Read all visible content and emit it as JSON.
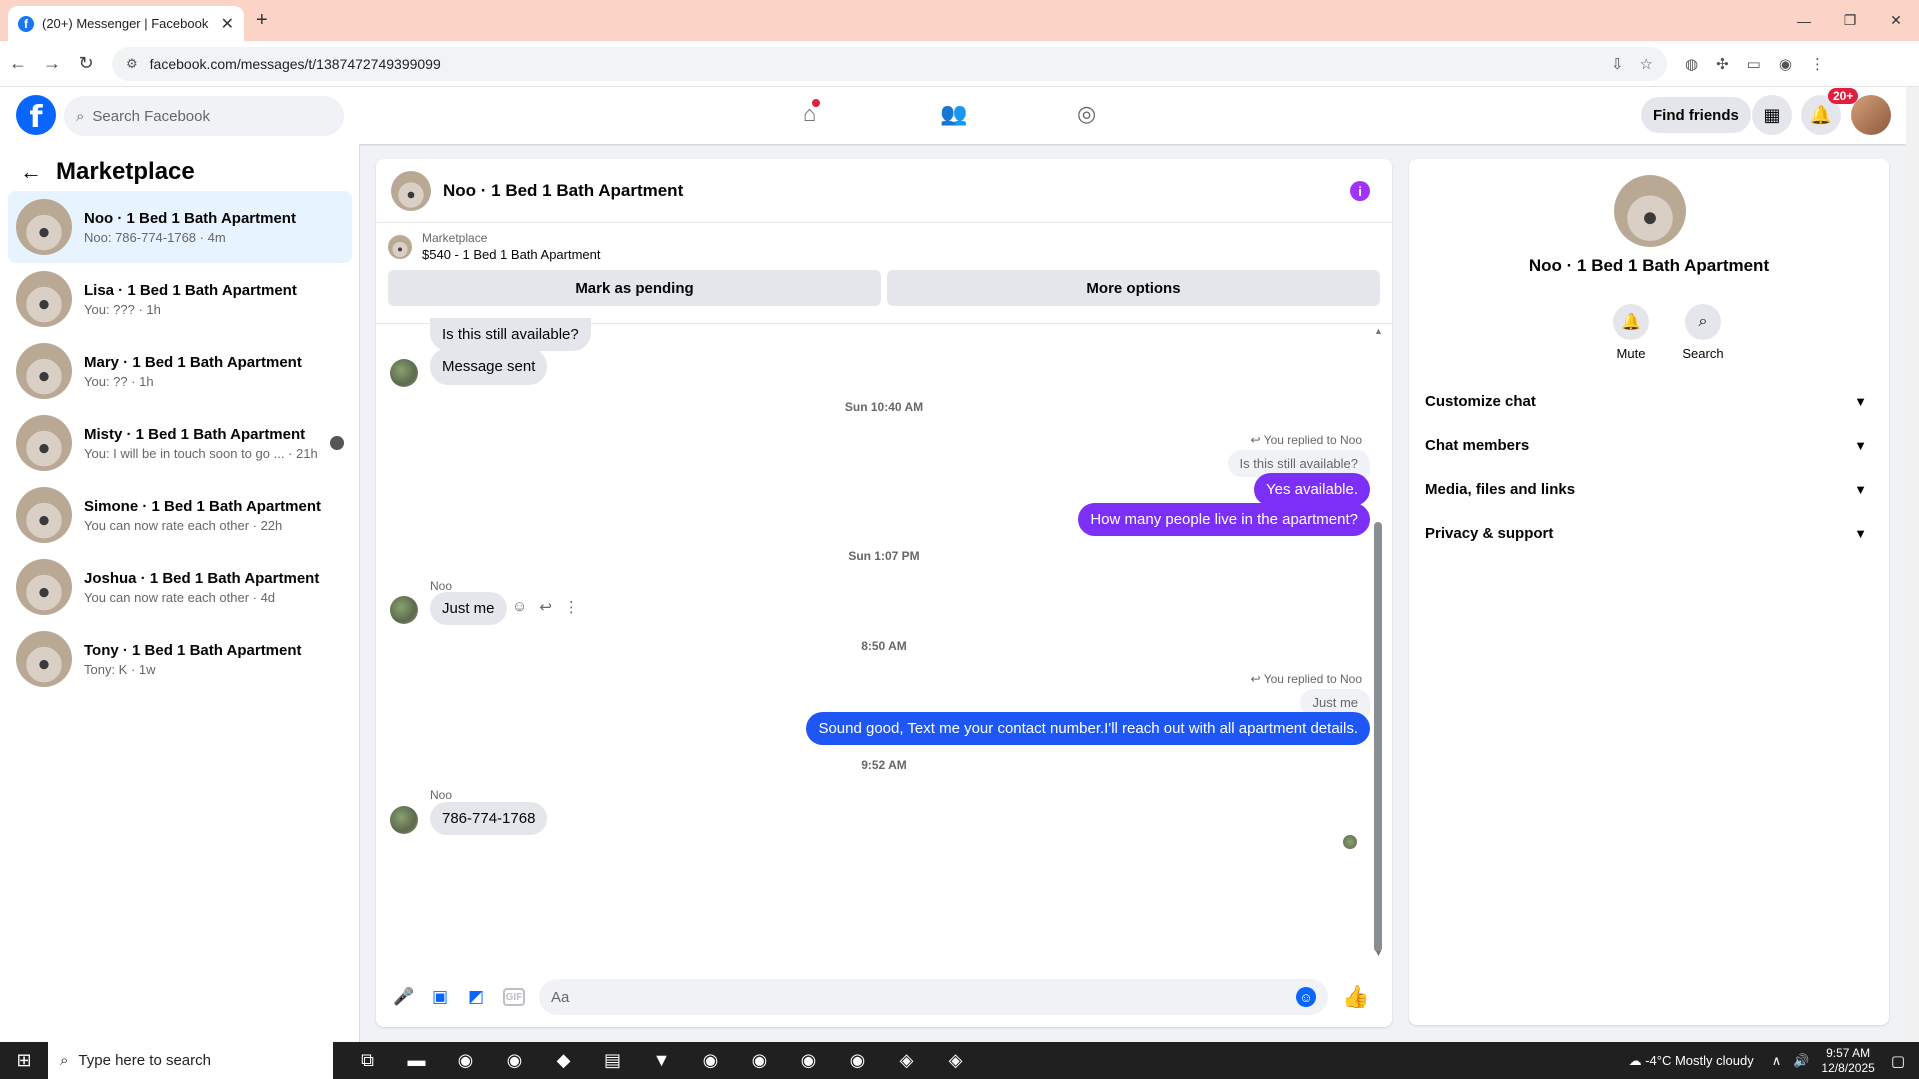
{
  "browser": {
    "tab_title": "(20+) Messenger | Facebook",
    "url": "facebook.com/messages/t/1387472749399099"
  },
  "fb": {
    "search_placeholder": "Search Facebook",
    "find_friends": "Find friends",
    "notif_badge": "20+"
  },
  "sidebar": {
    "title": "Marketplace",
    "conversations": [
      {
        "name": "Noo · 1 Bed 1 Bath Apartment",
        "preview": "Noo: 786-774-1768 · 4m"
      },
      {
        "name": "Lisa · 1 Bed 1 Bath Apartment",
        "preview": "You: ??? · 1h"
      },
      {
        "name": "Mary · 1 Bed 1 Bath Apartment",
        "preview": "You: ?? · 1h"
      },
      {
        "name": "Misty · 1 Bed 1 Bath Apartment",
        "preview": "You: I will be in touch soon to go ... · 21h"
      },
      {
        "name": "Simone · 1 Bed 1 Bath Apartment",
        "preview": "You can now rate each other · 22h"
      },
      {
        "name": "Joshua · 1 Bed 1 Bath Apartment",
        "preview": "You can now rate each other · 4d"
      },
      {
        "name": "Tony · 1 Bed 1 Bath Apartment",
        "preview": "Tony: K · 1w"
      }
    ]
  },
  "chat": {
    "title": "Noo · 1 Bed 1 Bath Apartment",
    "listing_source": "Marketplace",
    "listing_title": "$540 - 1 Bed 1 Bath Apartment",
    "btn_pending": "Mark as pending",
    "btn_more": "More options",
    "messages": {
      "m1": "Is this still available?",
      "m2": "Message sent",
      "ts1": "Sun 10:40 AM",
      "reply1_label": "You replied to Noo",
      "reply1_quote": "Is this still available?",
      "m3": "Yes available.",
      "m4": "How many people live in the apartment?",
      "ts2": "Sun 1:07 PM",
      "sender1": "Noo",
      "m5": "Just me",
      "ts3": "8:50 AM",
      "reply2_label": "You replied to Noo",
      "reply2_quote": "Just me",
      "m6": "Sound good, Text me your contact number.I'll reach out with all apartment details.",
      "ts4": "9:52 AM",
      "sender2": "Noo",
      "m7": "786-774-1768"
    },
    "composer_placeholder": "Aa",
    "gif_label": "GIF"
  },
  "info": {
    "name": "Noo · 1 Bed 1 Bath Apartment",
    "mute": "Mute",
    "search": "Search",
    "sections": [
      "Customize chat",
      "Chat members",
      "Media, files and links",
      "Privacy & support"
    ]
  },
  "taskbar": {
    "search_placeholder": "Type here to search",
    "weather": "-4°C  Mostly cloudy",
    "time": "9:57 AM",
    "date": "12/8/2025"
  }
}
